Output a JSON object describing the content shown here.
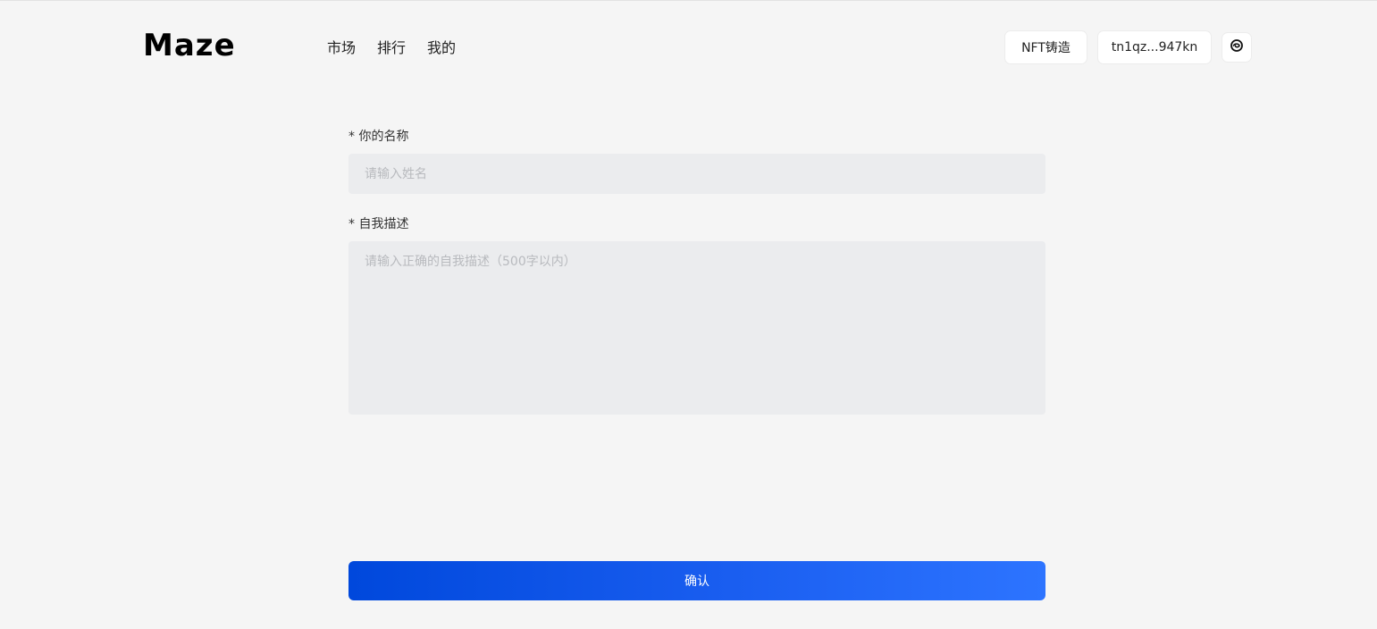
{
  "header": {
    "logo": "Maze",
    "nav": [
      {
        "label": "市场"
      },
      {
        "label": "排行"
      },
      {
        "label": "我的"
      }
    ],
    "mint_button": "NFT铸造",
    "wallet_address": "tn1qz...947kn",
    "theme_icon": "swirl-icon"
  },
  "form": {
    "name_label": "* 你的名称",
    "name_placeholder": "请输入姓名",
    "name_value": "",
    "desc_label": "* 自我描述",
    "desc_placeholder": "请输入正确的自我描述（500字以内）",
    "desc_value": "",
    "confirm_label": "确认"
  },
  "colors": {
    "background": "#f5f5f5",
    "input_background": "#ebecee",
    "button_gradient_start": "#0048dc",
    "button_gradient_end": "#2d74ff"
  }
}
